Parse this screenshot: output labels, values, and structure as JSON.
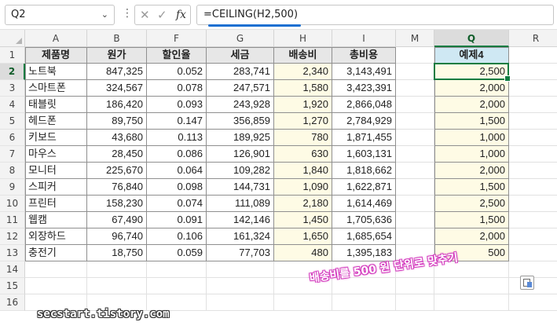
{
  "formula_bar": {
    "name_box": "Q2",
    "formula": "=CEILING(H2,500)",
    "fx_label": "fx",
    "cancel_glyph": "✕",
    "enter_glyph": "✓"
  },
  "columns": [
    "A",
    "B",
    "F",
    "G",
    "H",
    "I",
    "M",
    "Q",
    "R"
  ],
  "rows": [
    "1",
    "2",
    "3",
    "4",
    "5",
    "6",
    "7",
    "8",
    "9",
    "10",
    "11",
    "12",
    "13",
    "14",
    "15",
    "16"
  ],
  "table": {
    "headers": [
      "제품명",
      "원가",
      "할인율",
      "세금",
      "배송비",
      "총비용"
    ],
    "rows": [
      [
        "노트북",
        "847,325",
        "0.052",
        "283,741",
        "2,340",
        "3,143,491"
      ],
      [
        "스마트폰",
        "324,567",
        "0.078",
        "247,571",
        "1,580",
        "3,423,391"
      ],
      [
        "태블릿",
        "186,420",
        "0.093",
        "243,928",
        "1,920",
        "2,866,048"
      ],
      [
        "헤드폰",
        "89,750",
        "0.147",
        "356,859",
        "1,270",
        "2,784,929"
      ],
      [
        "키보드",
        "43,680",
        "0.113",
        "189,925",
        "780",
        "1,871,455"
      ],
      [
        "마우스",
        "28,450",
        "0.086",
        "126,901",
        "630",
        "1,603,131"
      ],
      [
        "모니터",
        "225,670",
        "0.064",
        "109,282",
        "1,840",
        "1,818,662"
      ],
      [
        "스피커",
        "76,840",
        "0.098",
        "144,731",
        "1,090",
        "1,622,871"
      ],
      [
        "프린터",
        "158,230",
        "0.074",
        "111,089",
        "2,180",
        "1,614,469"
      ],
      [
        "웹캠",
        "67,490",
        "0.091",
        "142,146",
        "1,450",
        "1,705,636"
      ],
      [
        "외장하드",
        "96,740",
        "0.106",
        "161,324",
        "1,650",
        "1,685,654"
      ],
      [
        "충전기",
        "18,750",
        "0.059",
        "77,703",
        "480",
        "1,395,183"
      ]
    ]
  },
  "result": {
    "header": "예제4",
    "values": [
      "2,500",
      "2,000",
      "2,000",
      "1,500",
      "1,000",
      "1,000",
      "2,000",
      "1,500",
      "2,500",
      "1,500",
      "2,000",
      "500"
    ]
  },
  "annotation": "배송비를 500 원 단위로 맞추기",
  "watermark": "secstart.tistory.com",
  "colors": {
    "selection": "#107c41",
    "header_fill": "#e7e7e7",
    "result_header_fill": "#cfe8f3",
    "highlight_fill": "#fefbe5",
    "formula_underline": "#1a6fd1",
    "annotation": "#d43cbf"
  }
}
